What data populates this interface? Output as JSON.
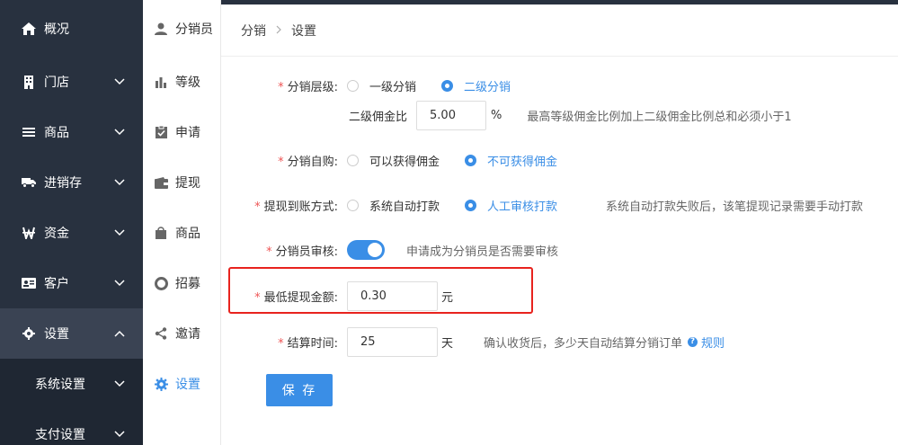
{
  "sidebar": {
    "items": [
      {
        "label": "概况",
        "icon": "home-icon"
      },
      {
        "label": "门店",
        "icon": "store-icon"
      },
      {
        "label": "商品",
        "icon": "list-icon"
      },
      {
        "label": "进销存",
        "icon": "truck-icon"
      },
      {
        "label": "资金",
        "icon": "yen-icon"
      },
      {
        "label": "客户",
        "icon": "id-card-icon"
      },
      {
        "label": "设置",
        "icon": "gear-icon"
      }
    ],
    "sub_items": [
      {
        "label": "系统设置"
      },
      {
        "label": "支付设置"
      }
    ]
  },
  "subnav": {
    "items": [
      {
        "label": "分销员",
        "icon": "user-icon"
      },
      {
        "label": "等级",
        "icon": "bar-chart-icon"
      },
      {
        "label": "申请",
        "icon": "clipboard-check-icon"
      },
      {
        "label": "提现",
        "icon": "wallet-icon"
      },
      {
        "label": "商品",
        "icon": "bag-icon"
      },
      {
        "label": "招募",
        "icon": "lifebuoy-icon"
      },
      {
        "label": "邀请",
        "icon": "share-icon"
      },
      {
        "label": "设置",
        "icon": "gear-icon"
      }
    ]
  },
  "breadcrumb": {
    "parent": "分销",
    "current": "设置"
  },
  "form": {
    "level": {
      "label": "分销层级:",
      "options": [
        "一级分销",
        "二级分销"
      ],
      "selected": "二级分销"
    },
    "commission": {
      "label": "二级佣金比",
      "value": "5.00",
      "unit": "%",
      "hint": "最高等级佣金比例加上二级佣金比例总和必须小于1"
    },
    "self_purchase": {
      "label": "分销自购:",
      "options": [
        "可以获得佣金",
        "不可获得佣金"
      ],
      "selected": "不可获得佣金"
    },
    "withdraw": {
      "label": "提现到账方式:",
      "options": [
        "系统自动打款",
        "人工审核打款"
      ],
      "selected": "人工审核打款",
      "hint": "系统自动打款失败后，该笔提现记录需要手动打款"
    },
    "review": {
      "label": "分销员审核:",
      "enabled": true,
      "hint": "申请成为分销员是否需要审核"
    },
    "min_withdraw": {
      "label": "最低提现金额:",
      "value": "0.30",
      "unit": "元"
    },
    "settle": {
      "label": "结算时间:",
      "value": "25",
      "unit": "天",
      "hint": "确认收货后，多少天自动结算分销订单",
      "link": "规则"
    },
    "save_label": "保 存"
  },
  "colors": {
    "sidebar_bg": "#28313f",
    "accent": "#3a8ee6",
    "required_star": "#e55555",
    "highlight_box": "#e8231e"
  }
}
